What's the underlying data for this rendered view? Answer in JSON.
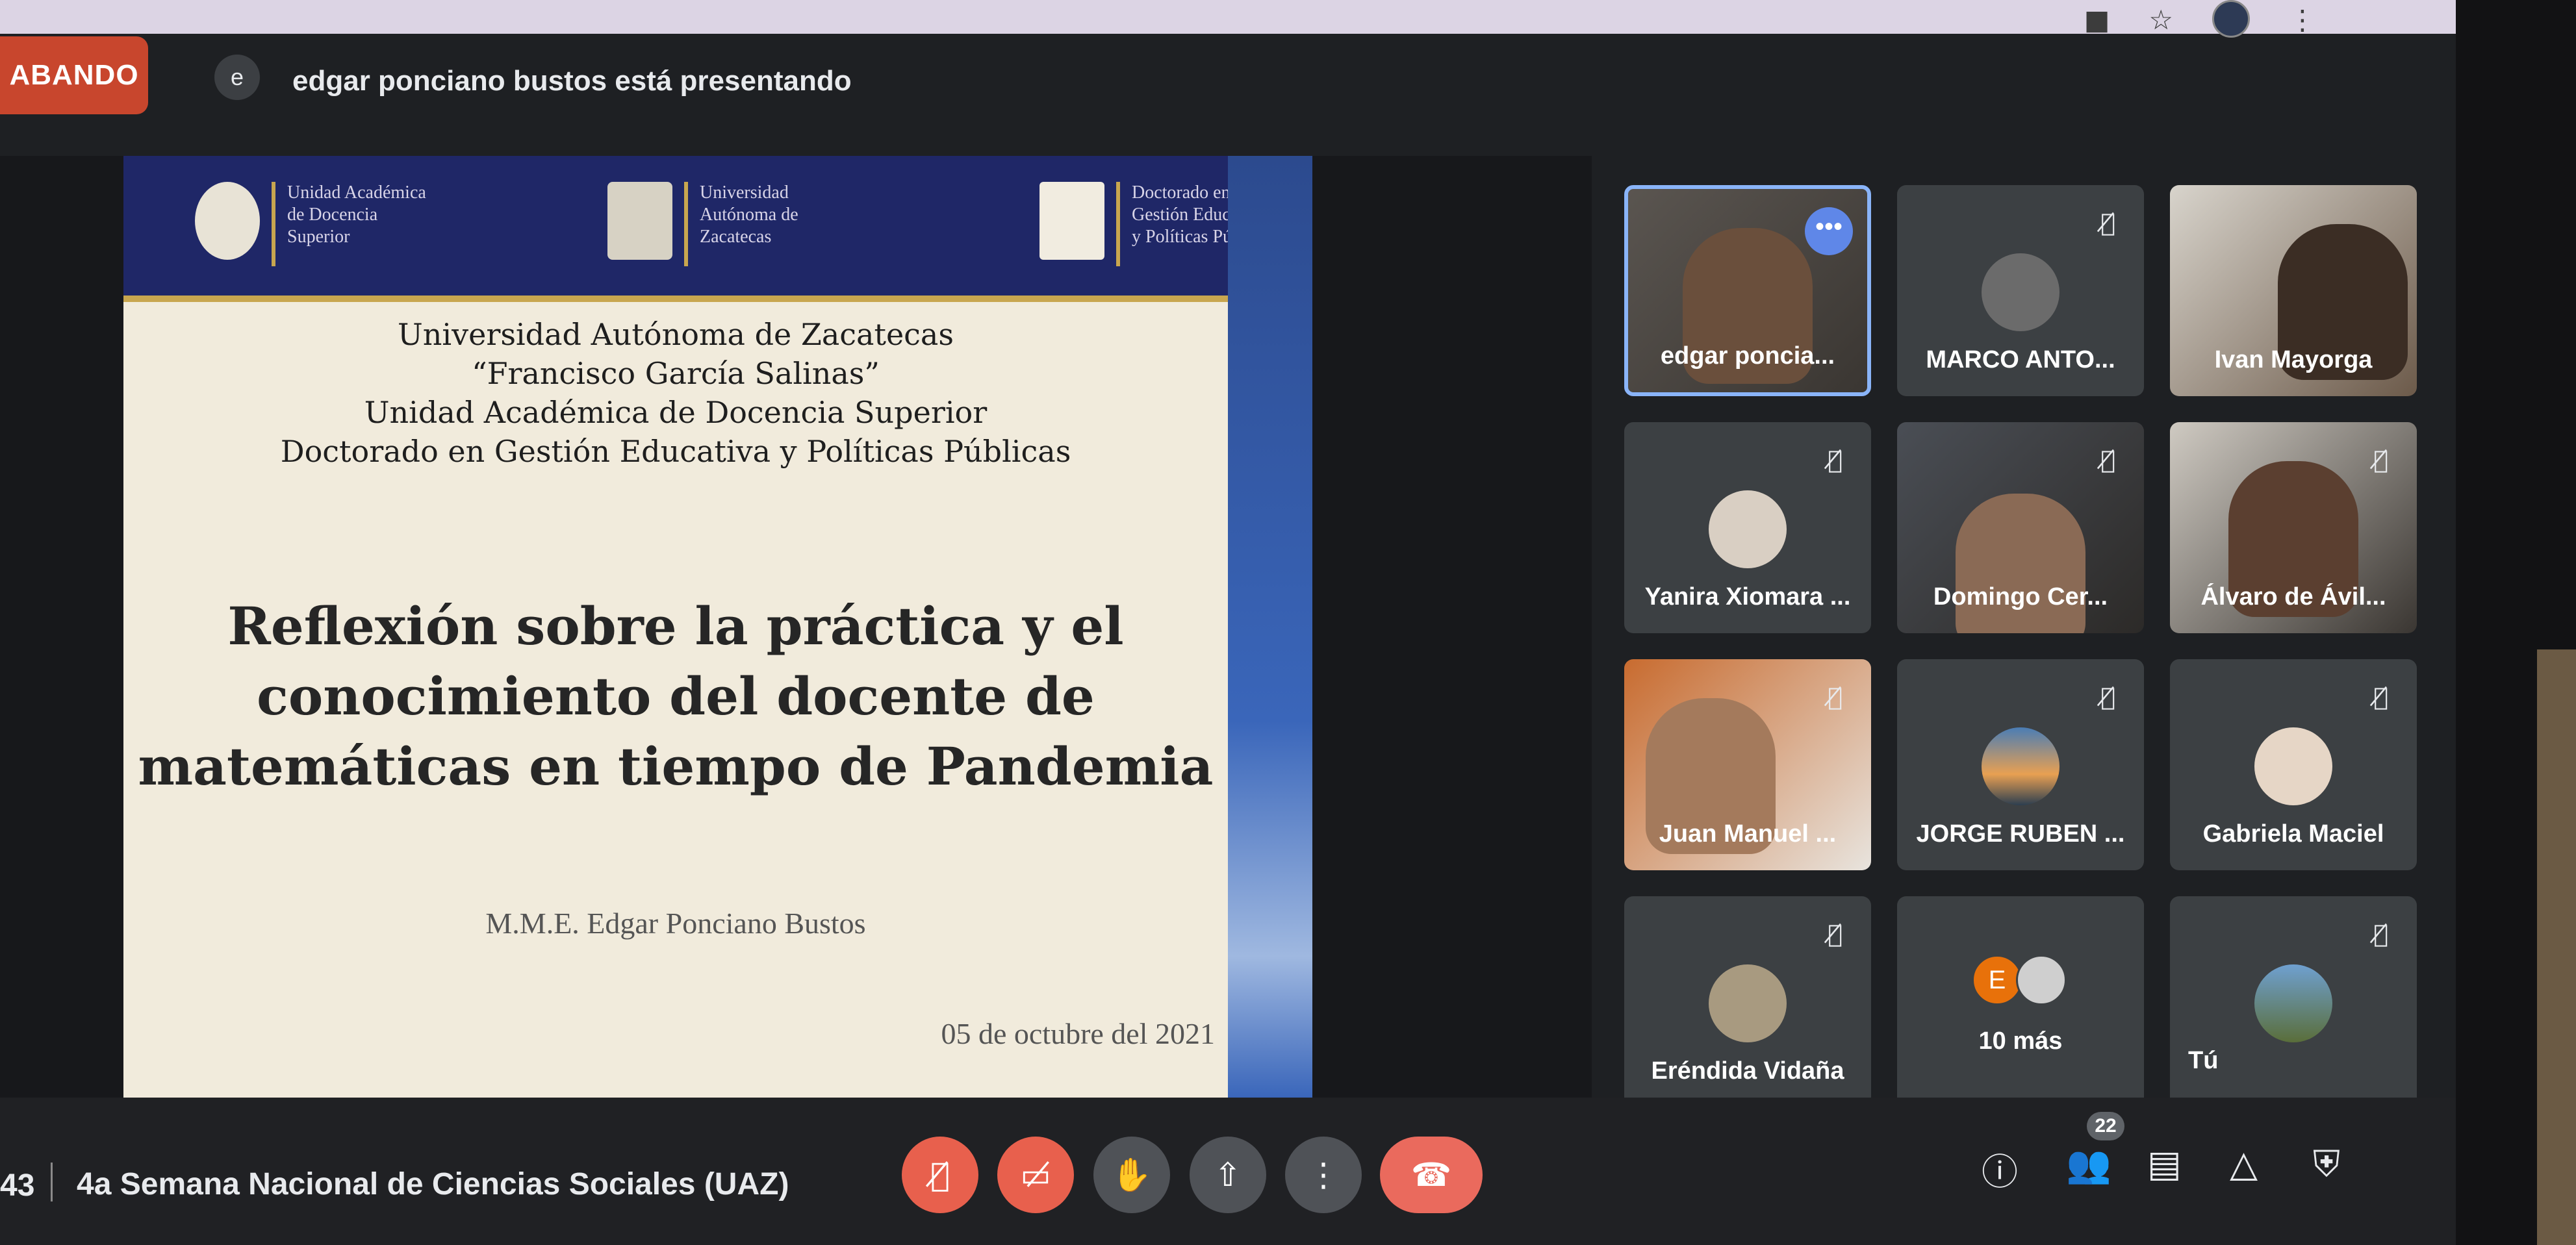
{
  "meet": {
    "recording_label": "ABANDO",
    "presenter_initial": "e",
    "presenter_text": "edgar ponciano bustos está presentando"
  },
  "slide": {
    "logos": [
      {
        "text": "Unidad Académica\nde Docencia\nSuperior"
      },
      {
        "text": "Universidad\nAutónoma de\nZacatecas"
      },
      {
        "text": "Doctorado en\nGestión Educativa\ny Políticas Públicas"
      }
    ],
    "header_lines": [
      "Universidad Autónoma de Zacatecas",
      "“Francisco García Salinas”",
      "Unidad Académica de Docencia Superior",
      "Doctorado en Gestión Educativa y Políticas Públicas"
    ],
    "title_lines": [
      "Reflexión sobre la práctica y el",
      "conocimiento del docente de",
      "matemáticas en tiempo de Pandemia"
    ],
    "author": "M.M.E. Edgar Ponciano Bustos",
    "date": "05 de octubre del 2021"
  },
  "participants": [
    {
      "name": "edgar poncia...",
      "type": "video",
      "active": true
    },
    {
      "name": "MARCO ANTO...",
      "type": "avatar",
      "muted": true
    },
    {
      "name": "Ivan Mayorga",
      "type": "video"
    },
    {
      "name": "Yanira Xiomara ...",
      "type": "avatar",
      "muted": true
    },
    {
      "name": "Domingo Cer...",
      "type": "video",
      "muted": true
    },
    {
      "name": "Álvaro de Ávil...",
      "type": "video",
      "muted": true
    },
    {
      "name": "Juan Manuel ...",
      "type": "video",
      "muted": true
    },
    {
      "name": "JORGE RUBEN ...",
      "type": "avatar",
      "muted": true
    },
    {
      "name": "Gabriela Maciel",
      "type": "avatar",
      "muted": true
    },
    {
      "name": "Eréndida Vidaña",
      "type": "avatar",
      "muted": true
    },
    {
      "name": "10 más",
      "type": "more",
      "initial": "E"
    },
    {
      "name": "Tú",
      "type": "avatar",
      "muted": true
    }
  ],
  "bottom": {
    "time": "43",
    "meeting_name": "4a Semana Nacional de Ciencias Sociales (UAZ)",
    "participant_count": "22"
  },
  "icons": {
    "mic_off": "mic-off-icon",
    "cam_off": "camera-off-icon",
    "raise_hand": "hand-icon",
    "present": "present-icon",
    "more": "more-vert-icon",
    "hangup": "hangup-icon",
    "info": "info-icon",
    "people": "people-icon",
    "chat": "chat-icon",
    "activities": "activities-icon",
    "host_controls": "shield-icon"
  },
  "colors": {
    "background": "#202124",
    "recording": "#c8462d",
    "hangup": "#ea6a5d",
    "active_border": "#8ab4f8",
    "slide_header": "#1f2767"
  }
}
